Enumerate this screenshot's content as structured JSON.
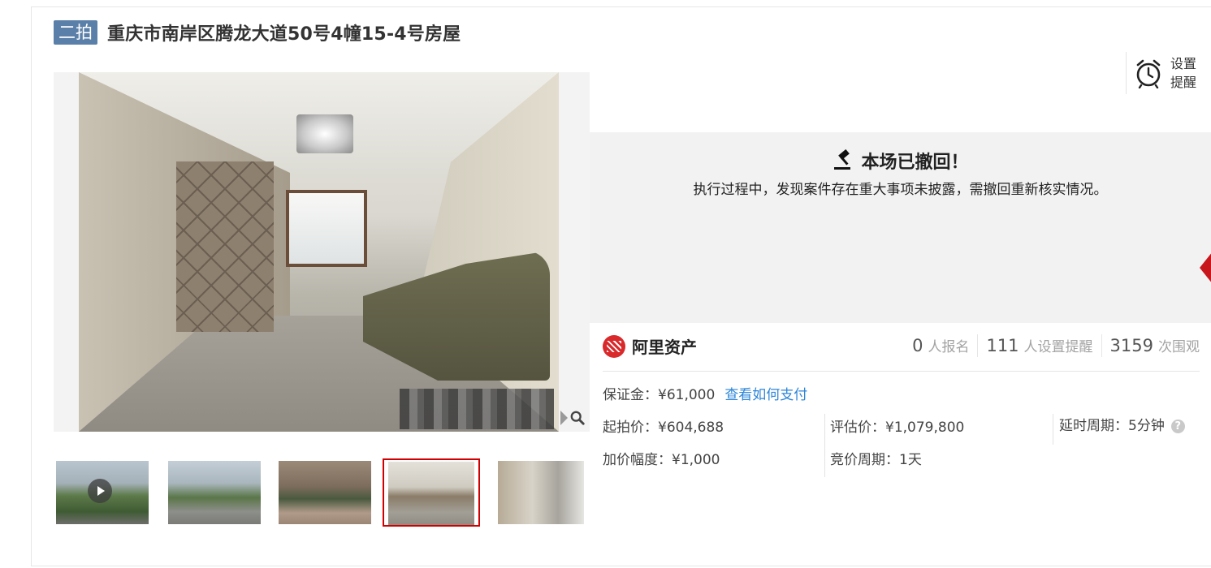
{
  "header": {
    "round_badge": "二拍",
    "title": "重庆市南岸区腾龙大道50号4幢15-4号房屋"
  },
  "reminder": {
    "label": "设置提醒",
    "icon": "alarm-clock-icon"
  },
  "notice": {
    "title": "本场已撤回！",
    "text": "执行过程中，发现案件存在重大事项未披露，需撤回重新核实情况。",
    "icon": "gavel-icon"
  },
  "platform": {
    "name": "阿里资产",
    "brand_color": "#d9292b"
  },
  "stats": [
    {
      "value": "0",
      "unit": "人报名"
    },
    {
      "value": "111",
      "unit": "人设置提醒"
    },
    {
      "value": "3159",
      "unit": "次围观"
    }
  ],
  "info": {
    "deposit": "保证金：¥61,000",
    "pay_link": "查看如何支付",
    "start_price": "起拍价：¥604,688",
    "appraisal": "评估价：¥1,079,800",
    "delay_period": "延时周期：5分钟",
    "increment": "加价幅度：¥1,000",
    "bid_period": "竞价周期：1天"
  },
  "gallery": {
    "active_index": 3,
    "thumbnails": [
      {
        "type": "video",
        "icon": "play-icon"
      },
      {
        "type": "image"
      },
      {
        "type": "image"
      },
      {
        "type": "image"
      },
      {
        "type": "image"
      }
    ]
  },
  "colors": {
    "badge_bg": "#5a7fa8",
    "active_thumb_border": "#d00000",
    "link": "#2d86d8",
    "notice_bg": "#f2f2f2"
  }
}
